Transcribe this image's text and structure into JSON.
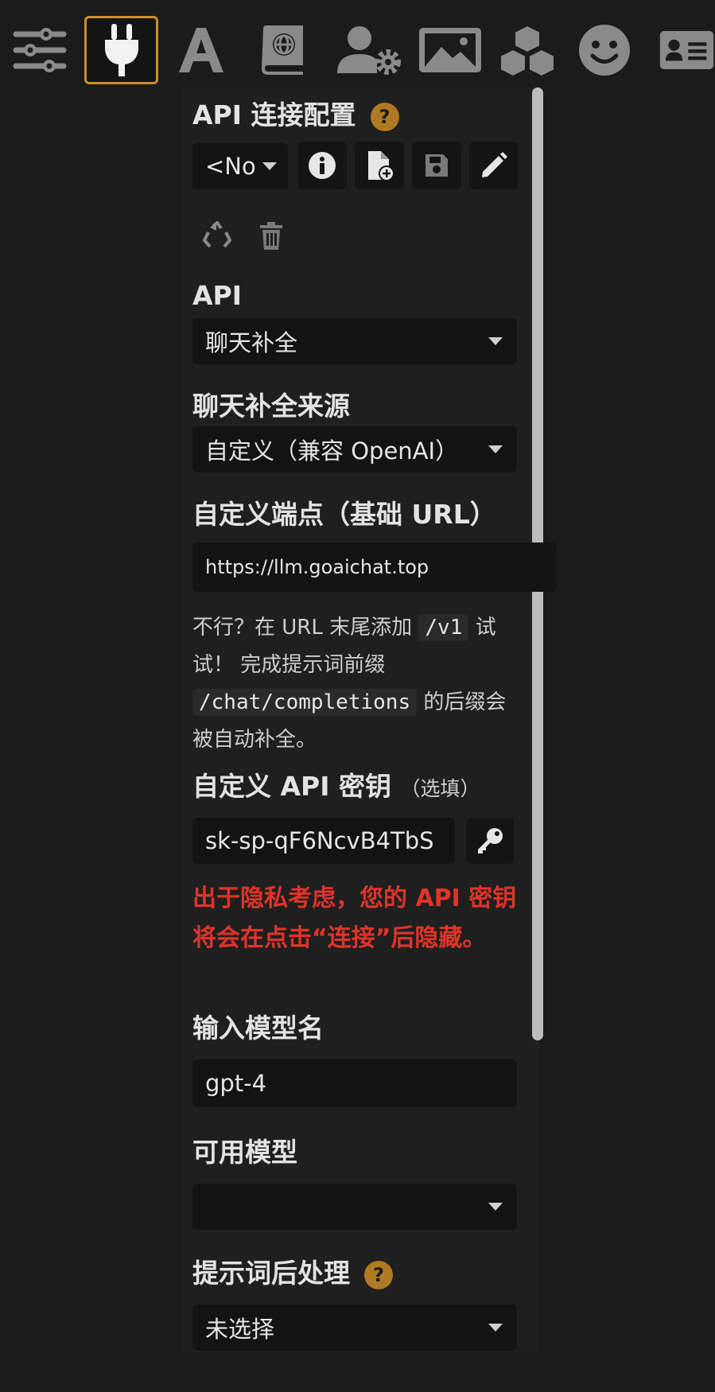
{
  "toolbar": {
    "icons": [
      "sliders-icon",
      "plug-icon",
      "text-font-icon",
      "globe-book-icon",
      "user-gear-icon",
      "image-landscape-icon",
      "cubes-icon",
      "smiley-icon",
      "id-card-icon"
    ],
    "active": "plug-icon",
    "accent": "#c8902a"
  },
  "panel": {
    "connection_title": "API 连接配置",
    "help_mark": "?",
    "preset_value": "<No",
    "api_label": "API",
    "api_value": "聊天补全",
    "source_label": "聊天补全来源",
    "source_value": "自定义（兼容 OpenAI）",
    "endpoint_label": "自定义端点（基础 URL）",
    "endpoint_value": "https://llm.goaichat.top",
    "hint": {
      "part1": "不行？在 URL 末尾添加 ",
      "code1": "/v1",
      "part2": " 试试！ 完成提示词前缀 ",
      "code2": "/chat/completions",
      "part3": " 的后缀会被自动补全。"
    },
    "key_label": "自定义 API 密钥",
    "key_label_note": "（选填）",
    "key_value": "sk-sp-qF6NcvB4TbS",
    "privacy_warning": "出于隐私考虑，您的 API 密钥将会在点击“连接”后隐藏。",
    "warning_color": "#e0332a",
    "model_label": "输入模型名",
    "model_value": "gpt-4",
    "available_label": "可用模型",
    "available_value": "",
    "postprocess_label": "提示词后处理",
    "postprocess_value": "未选择"
  }
}
